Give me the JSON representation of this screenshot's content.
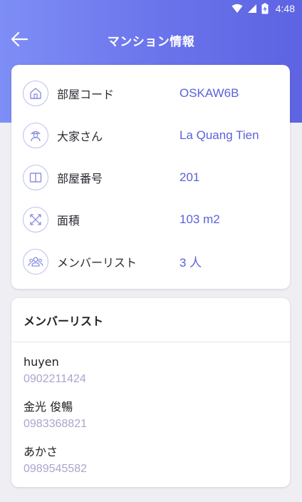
{
  "status_bar": {
    "time": "4:48"
  },
  "app_bar": {
    "title": "マンション情報"
  },
  "info": [
    {
      "icon": "home-icon",
      "label": "部屋コード",
      "value": "OSKAW6B"
    },
    {
      "icon": "landlord-icon",
      "label": "大家さん",
      "value": "La Quang Tien"
    },
    {
      "icon": "book-icon",
      "label": "部屋番号",
      "value": "201"
    },
    {
      "icon": "expand-icon",
      "label": "面積",
      "value": "103 m2"
    },
    {
      "icon": "members-icon",
      "label": "メンバーリスト",
      "value": "3 人"
    }
  ],
  "members_section": {
    "title": "メンバーリスト",
    "members": [
      {
        "name": "huyen",
        "phone": "0902211424"
      },
      {
        "name": "金光 俊暢",
        "phone": "0983368821"
      },
      {
        "name": "あかさ",
        "phone": "0989545582"
      }
    ]
  },
  "colors": {
    "accent": "#5a63d8",
    "header_start": "#7e8ef6",
    "header_end": "#5d63e2",
    "phone": "#a9a6cc"
  }
}
